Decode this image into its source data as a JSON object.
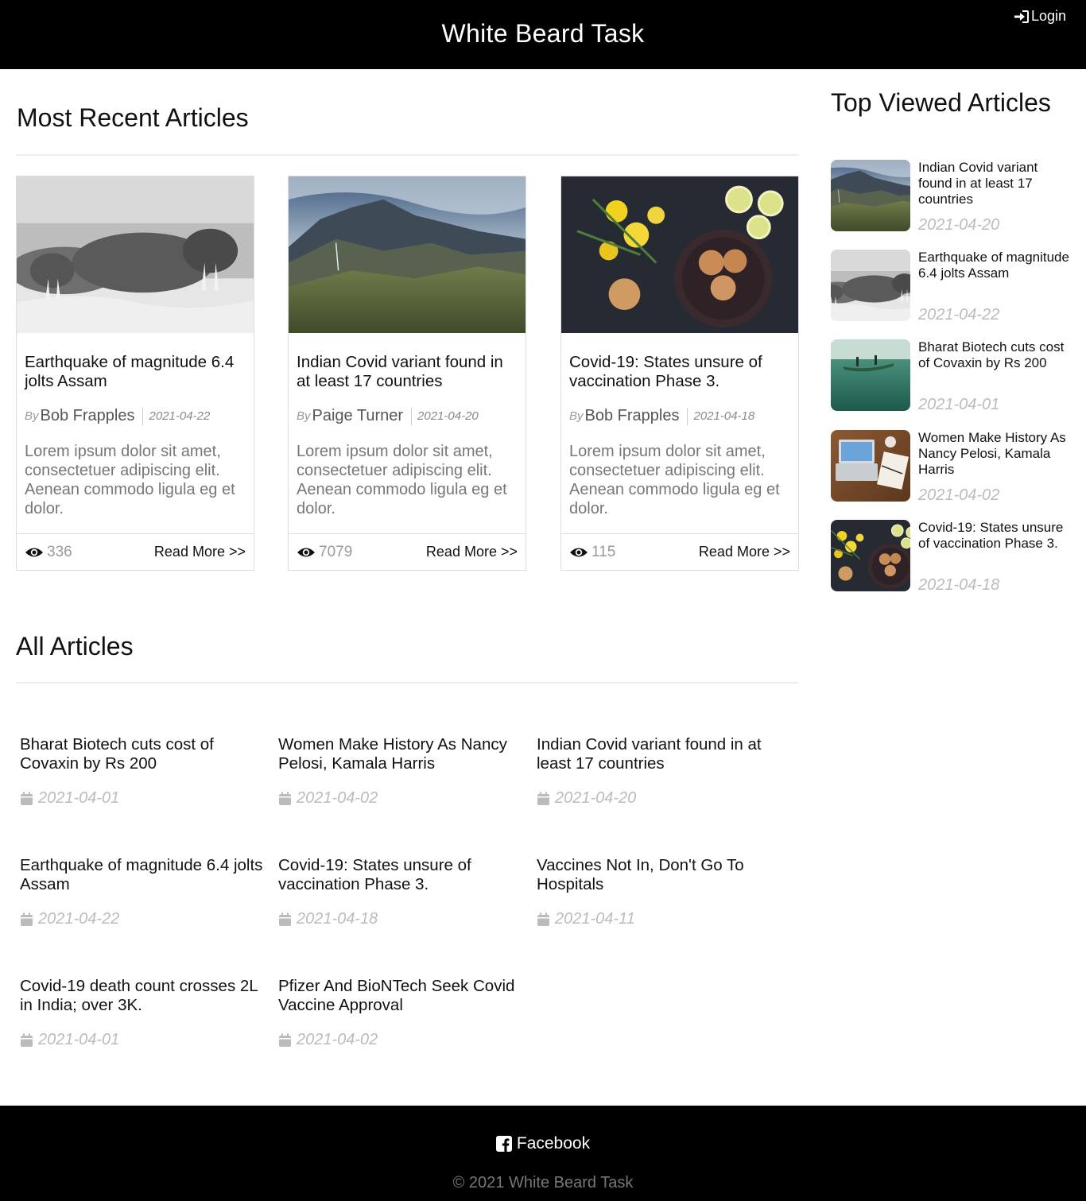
{
  "header": {
    "site_title": "White Beard Task",
    "login_label": "Login"
  },
  "recent": {
    "title": "Most Recent Articles",
    "by_label": "By",
    "read_more": "Read More >>",
    "cards": [
      {
        "title": "Earthquake of magnitude 6.4 jolts Assam",
        "author": "Bob Frapples",
        "date": "2021-04-22",
        "excerpt": "Lorem ipsum dolor sit amet, consectetuer adipiscing elit. Aenean commodo ligula eg et dolor.",
        "views": "336",
        "image": "walrus"
      },
      {
        "title": "Indian Covid variant found in at least 17 countries",
        "author": "Paige Turner",
        "date": "2021-04-20",
        "excerpt": "Lorem ipsum dolor sit amet, consectetuer adipiscing elit. Aenean commodo ligula eg et dolor.",
        "views": "7079",
        "image": "mountain"
      },
      {
        "title": "Covid-19: States unsure of vaccination Phase 3.",
        "author": "Bob Frapples",
        "date": "2021-04-18",
        "excerpt": "Lorem ipsum dolor sit amet, consectetuer adipiscing elit. Aenean commodo ligula eg et dolor.",
        "views": "115",
        "image": "cookies"
      }
    ]
  },
  "top_viewed": {
    "title": "Top Viewed Articles",
    "items": [
      {
        "title": "Indian Covid variant found in at least 17 countries",
        "date": "2021-04-20",
        "image": "mountain"
      },
      {
        "title": "Earthquake of magnitude 6.4 jolts Assam",
        "date": "2021-04-22",
        "image": "walrus"
      },
      {
        "title": "Bharat Biotech cuts cost of Covaxin by Rs 200",
        "date": "2021-04-01",
        "image": "boat"
      },
      {
        "title": "Women Make History As Nancy Pelosi, Kamala Harris",
        "date": "2021-04-02",
        "image": "laptop"
      },
      {
        "title": "Covid-19: States unsure of vaccination Phase 3.",
        "date": "2021-04-18",
        "image": "cookies"
      }
    ]
  },
  "all_articles": {
    "title": "All Articles",
    "items": [
      {
        "title": "Bharat Biotech cuts cost of Covaxin by Rs 200",
        "date": "2021-04-01"
      },
      {
        "title": "Women Make History As Nancy Pelosi, Kamala Harris",
        "date": "2021-04-02"
      },
      {
        "title": "Indian Covid variant found in at least 17 countries",
        "date": "2021-04-20"
      },
      {
        "title": "Earthquake of magnitude 6.4 jolts Assam",
        "date": "2021-04-22"
      },
      {
        "title": "Covid-19: States unsure of vaccination Phase 3.",
        "date": "2021-04-18"
      },
      {
        "title": "Vaccines Not In, Don't Go To Hospitals",
        "date": "2021-04-11"
      },
      {
        "title": "Covid-19 death count crosses 2L in India; over 3K.",
        "date": "2021-04-01"
      },
      {
        "title": "Pfizer And BioNTech Seek Covid Vaccine Approval",
        "date": "2021-04-02"
      }
    ]
  },
  "footer": {
    "facebook_label": "Facebook",
    "copyright": "© 2021 White Beard Task"
  },
  "icons": {
    "login": "sign-in-icon",
    "views": "eye-icon",
    "date": "calendar-icon",
    "facebook": "facebook-icon"
  },
  "colors": {
    "header_bg": "#000000",
    "footer_bg": "#000000",
    "date_text": "#bbbbbb"
  }
}
